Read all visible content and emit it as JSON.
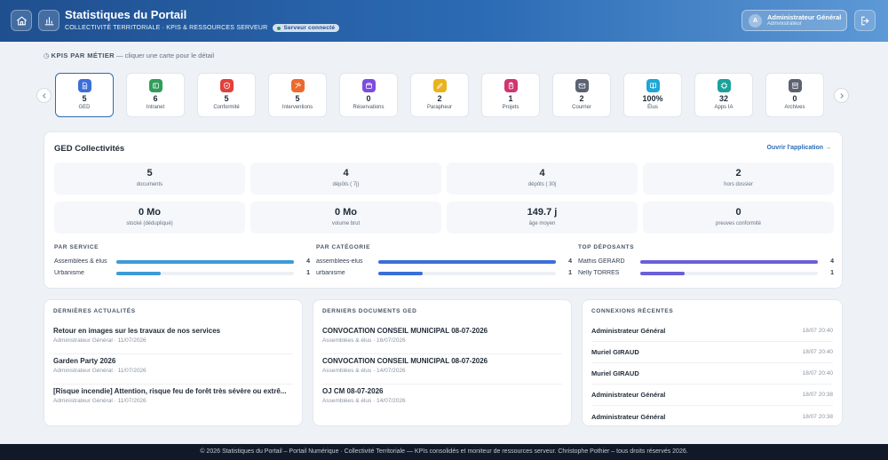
{
  "header": {
    "title": "Statistiques du Portail",
    "subtitle": "COLLECTIVITÉ TERRITORIALE · KPIS & RESSOURCES SERVEUR",
    "badge": "Serveur connecté",
    "user": {
      "initial": "A",
      "name": "Administrateur Général",
      "role": "Administrateur"
    },
    "icons": {
      "home": "home-icon",
      "stats": "bar-chart-icon",
      "logout": "logout-icon"
    }
  },
  "kpis": {
    "caption_title": "KPIS PAR MÉTIER",
    "caption_hint": "— cliquer une carte pour le détail",
    "cards": [
      {
        "value": "5",
        "label": "GED",
        "color": "#3b6fd8",
        "icon": "document-icon"
      },
      {
        "value": "6",
        "label": "Intranet",
        "color": "#2f9e5a",
        "icon": "intranet-icon"
      },
      {
        "value": "5",
        "label": "Conformité",
        "color": "#e0413a",
        "icon": "shield-icon"
      },
      {
        "value": "5",
        "label": "Interventions",
        "color": "#ec6a2c",
        "icon": "tools-icon"
      },
      {
        "value": "0",
        "label": "Réservations",
        "color": "#7c4ddd",
        "icon": "calendar-icon"
      },
      {
        "value": "2",
        "label": "Parapheur",
        "color": "#e9b21f",
        "icon": "pen-icon"
      },
      {
        "value": "1",
        "label": "Projets",
        "color": "#d0366e",
        "icon": "clipboard-icon"
      },
      {
        "value": "2",
        "label": "Courrier",
        "color": "#5a6272",
        "icon": "mail-icon"
      },
      {
        "value": "100%",
        "label": "Élus",
        "color": "#1ea7d6",
        "icon": "book-icon"
      },
      {
        "value": "32",
        "label": "Apps IA",
        "color": "#1aa29a",
        "icon": "chip-icon"
      },
      {
        "value": "0",
        "label": "Archives",
        "color": "#5b6270",
        "icon": "archive-icon"
      }
    ]
  },
  "ged": {
    "title": "GED Collectivités",
    "open_link": "Ouvrir l'application →",
    "stats": [
      {
        "value": "5",
        "label": "documents"
      },
      {
        "value": "4",
        "label": "dépôts ( 7j)"
      },
      {
        "value": "4",
        "label": "dépôts ( 30j"
      },
      {
        "value": "2",
        "label": "hors dossier"
      },
      {
        "value": "0 Mo",
        "label": "stocké (dédupliqué)"
      },
      {
        "value": "0 Mo",
        "label": "volume brut"
      },
      {
        "value": "149.7 j",
        "label": "âge moyen"
      },
      {
        "value": "0",
        "label": "preuves conformité"
      }
    ],
    "breakdowns": [
      {
        "title": "PAR SERVICE",
        "color": "#3d9bd6",
        "rows": [
          {
            "name": "Assemblées & élus",
            "count": 4,
            "ratio": 1.0
          },
          {
            "name": "Urbanisme",
            "count": 1,
            "ratio": 0.25
          }
        ]
      },
      {
        "title": "PAR CATÉGORIE",
        "color": "#3b6fd8",
        "rows": [
          {
            "name": "assemblees-elus",
            "count": 4,
            "ratio": 1.0
          },
          {
            "name": "urbanisme",
            "count": 1,
            "ratio": 0.25
          }
        ]
      },
      {
        "title": "TOP DÉPOSANTS",
        "color": "#6a5fd8",
        "rows": [
          {
            "name": "Mathis GÉRARD",
            "count": 4,
            "ratio": 1.0
          },
          {
            "name": "Nelly TORRES",
            "count": 1,
            "ratio": 0.25
          }
        ]
      }
    ]
  },
  "news": {
    "title": "DERNIÈRES ACTUALITÉS",
    "items": [
      {
        "title": "Retour en images sur les travaux de nos services",
        "meta": "Administrateur Général · 11/07/2026"
      },
      {
        "title": "Garden Party 2026",
        "meta": "Administrateur Général · 11/07/2026"
      },
      {
        "title": "[Risque incendie] Attention, risque feu de forêt très sévère ou extrê...",
        "meta": "Administrateur Général · 11/07/2026"
      }
    ]
  },
  "docs": {
    "title": "DERNIERS DOCUMENTS GED",
    "items": [
      {
        "title": "CONVOCATION CONSEIL MUNICIPAL 08-07-2026",
        "meta": "Assemblées & élus · 16/07/2026"
      },
      {
        "title": "CONVOCATION CONSEIL MUNICIPAL 08-07-2026",
        "meta": "Assemblées & élus · 14/07/2026"
      },
      {
        "title": "OJ CM 08-07-2026",
        "meta": "Assemblées & élus · 14/07/2026"
      }
    ]
  },
  "connections": {
    "title": "CONNEXIONS RÉCENTES",
    "items": [
      {
        "name": "Administrateur Général",
        "time": "18/07 20:40"
      },
      {
        "name": "Muriel GIRAUD",
        "time": "18/07 20:40"
      },
      {
        "name": "Muriel GIRAUD",
        "time": "18/07 20:40"
      },
      {
        "name": "Administrateur Général",
        "time": "18/07 20:38"
      },
      {
        "name": "Administrateur Général",
        "time": "18/07 20:38"
      }
    ]
  },
  "footer": {
    "text": "© 2026 Statistiques du Portail – Portail Numérique · Collectivité Territoriale — KPIs consolidés et moniteur de ressources serveur. Christophe Pothier – tous droits réservés 2026."
  }
}
